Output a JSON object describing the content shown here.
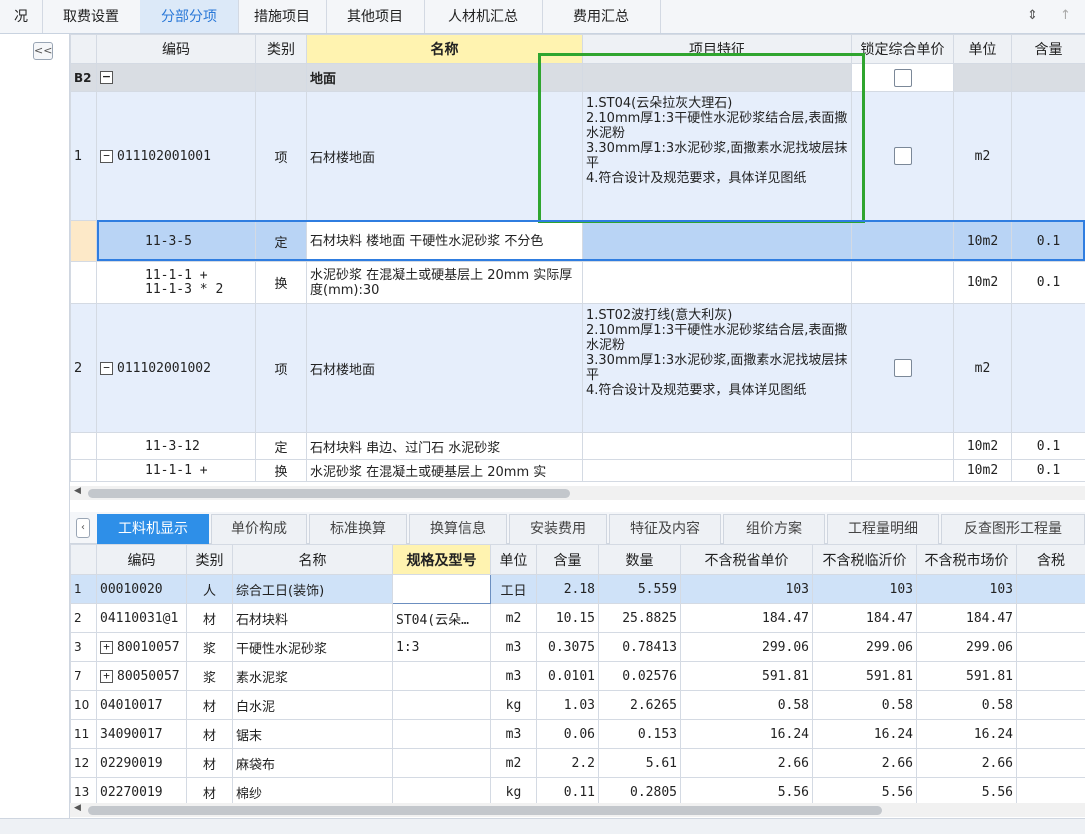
{
  "top_tabs": [
    {
      "label": "况",
      "active": false
    },
    {
      "label": "取费设置",
      "active": false
    },
    {
      "label": "分部分项",
      "active": true
    },
    {
      "label": "措施项目",
      "active": false
    },
    {
      "label": "其他项目",
      "active": false
    },
    {
      "label": "人材机汇总",
      "active": false
    },
    {
      "label": "费用汇总",
      "active": false
    }
  ],
  "collapse_label": "<<",
  "upper_headers": [
    "编码",
    "类别",
    "名称",
    "项目特征",
    "锁定综合单价",
    "单位",
    "含量"
  ],
  "group_row": {
    "id": "B2",
    "name": "地面"
  },
  "item1": {
    "num": "1",
    "code": "011102001001",
    "type": "项",
    "name": "石材楼地面",
    "features": [
      "1.ST04(云朵拉灰大理石)",
      "2.10mm厚1:3干硬性水泥砂浆结合层,表面撒水泥粉",
      "3.30mm厚1:3水泥砂浆,面撒素水泥找坡层抹平",
      "4.符合设计及规范要求，具体详见图纸"
    ],
    "unit": "m2"
  },
  "sub1": {
    "code": "11-3-5",
    "type": "定",
    "name": "石材块料 楼地面 干硬性水泥砂浆 不分色",
    "unit": "10m2",
    "qty": "0.1"
  },
  "sub2": {
    "code1": "11-1-1 +",
    "code2": "11-1-3 * 2",
    "type": "换",
    "name": "水泥砂浆 在混凝土或硬基层上 20mm 实际厚度(mm):30",
    "unit": "10m2",
    "qty": "0.1"
  },
  "item2": {
    "num": "2",
    "code": "011102001002",
    "type": "项",
    "name": "石材楼地面",
    "features": [
      "1.ST02波打线(意大利灰)",
      "2.10mm厚1:3干硬性水泥砂浆结合层,表面撒水泥粉",
      "3.30mm厚1:3水泥砂浆,面撒素水泥找坡层抹平",
      "4.符合设计及规范要求，具体详见图纸"
    ],
    "unit": "m2"
  },
  "sub3": {
    "code": "11-3-12",
    "type": "定",
    "name": "石材块料 串边、过门石 水泥砂浆",
    "unit": "10m2",
    "qty": "0.1"
  },
  "sub4": {
    "code": "11-1-1 +",
    "type": "换",
    "name": "水泥砂浆 在混凝土或硬基层上 20mm 实",
    "unit": "10m2",
    "qty": "0.1"
  },
  "lower_tabs": [
    {
      "label": "工料机显示",
      "active": true
    },
    {
      "label": "单价构成",
      "active": false
    },
    {
      "label": "标准换算",
      "active": false
    },
    {
      "label": "换算信息",
      "active": false
    },
    {
      "label": "安装费用",
      "active": false
    },
    {
      "label": "特征及内容",
      "active": false
    },
    {
      "label": "组价方案",
      "active": false
    },
    {
      "label": "工程量明细",
      "active": false
    },
    {
      "label": "反查图形工程量",
      "active": false
    }
  ],
  "lower_headers": [
    "编码",
    "类别",
    "名称",
    "规格及型号",
    "单位",
    "含量",
    "数量",
    "不含税省单价",
    "不含税临沂价",
    "不含税市场价",
    "含税"
  ],
  "lower_rows": [
    {
      "num": "1",
      "expand": false,
      "code": "00010020",
      "type": "人",
      "name": "综合工日(装饰)",
      "spec": "",
      "unit": "工日",
      "content": "2.18",
      "qty": "5.559",
      "p1": "103",
      "p2": "103",
      "p3": "103"
    },
    {
      "num": "2",
      "expand": false,
      "code": "04110031@1",
      "type": "材",
      "name": "石材块料",
      "spec": "ST04(云朵…",
      "unit": "m2",
      "content": "10.15",
      "qty": "25.8825",
      "p1": "184.47",
      "p2": "184.47",
      "p3": "184.47"
    },
    {
      "num": "3",
      "expand": true,
      "code": "80010057",
      "type": "浆",
      "name": "干硬性水泥砂浆",
      "spec": "1:3",
      "unit": "m3",
      "content": "0.3075",
      "qty": "0.78413",
      "p1": "299.06",
      "p2": "299.06",
      "p3": "299.06"
    },
    {
      "num": "7",
      "expand": true,
      "code": "80050057",
      "type": "浆",
      "name": "素水泥浆",
      "spec": "",
      "unit": "m3",
      "content": "0.0101",
      "qty": "0.02576",
      "p1": "591.81",
      "p2": "591.81",
      "p3": "591.81"
    },
    {
      "num": "10",
      "expand": false,
      "code": "04010017",
      "type": "材",
      "name": "白水泥",
      "spec": "",
      "unit": "kg",
      "content": "1.03",
      "qty": "2.6265",
      "p1": "0.58",
      "p2": "0.58",
      "p3": "0.58"
    },
    {
      "num": "11",
      "expand": false,
      "code": "34090017",
      "type": "材",
      "name": "锯末",
      "spec": "",
      "unit": "m3",
      "content": "0.06",
      "qty": "0.153",
      "p1": "16.24",
      "p2": "16.24",
      "p3": "16.24"
    },
    {
      "num": "12",
      "expand": false,
      "code": "02290019",
      "type": "材",
      "name": "麻袋布",
      "spec": "",
      "unit": "m2",
      "content": "2.2",
      "qty": "5.61",
      "p1": "2.66",
      "p2": "2.66",
      "p3": "2.66"
    },
    {
      "num": "13",
      "expand": false,
      "code": "02270019",
      "type": "材",
      "name": "棉纱",
      "spec": "",
      "unit": "kg",
      "content": "0.11",
      "qty": "0.2805",
      "p1": "5.56",
      "p2": "5.56",
      "p3": "5.56"
    }
  ]
}
